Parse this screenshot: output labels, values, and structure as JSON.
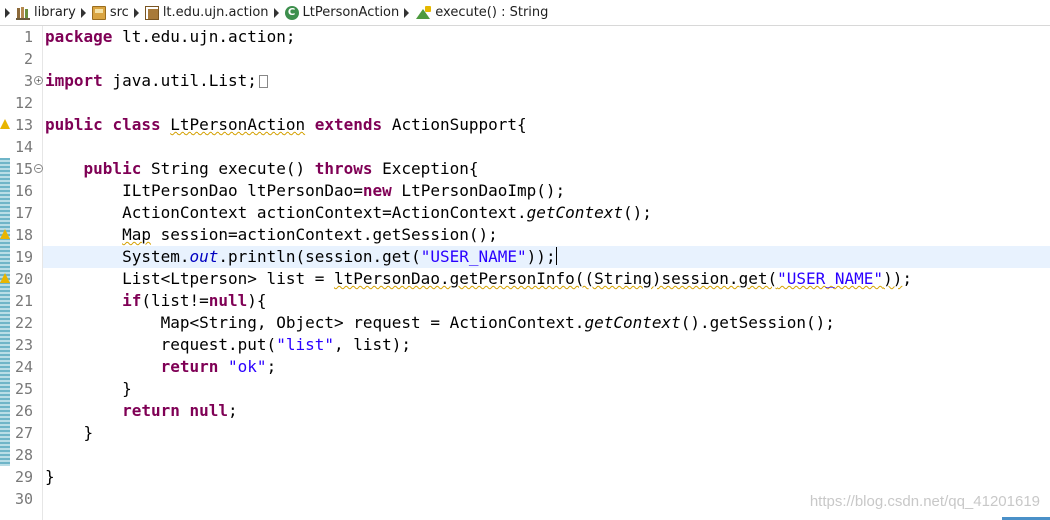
{
  "breadcrumb": {
    "items": [
      {
        "label": "library",
        "icon": "library-icon"
      },
      {
        "label": "src",
        "icon": "source-folder-icon"
      },
      {
        "label": "lt.edu.ujn.action",
        "icon": "package-icon"
      },
      {
        "label": "LtPersonAction",
        "icon": "class-icon"
      },
      {
        "label": "execute() : String",
        "icon": "method-icon"
      }
    ]
  },
  "editor": {
    "line_numbers": [
      "1",
      "2",
      "3",
      "12",
      "13",
      "14",
      "15",
      "16",
      "17",
      "18",
      "19",
      "20",
      "21",
      "22",
      "23",
      "24",
      "25",
      "26",
      "27",
      "28",
      "29",
      "30"
    ],
    "lines": [
      [
        {
          "t": "package",
          "k": "kw"
        },
        {
          "t": " lt.edu.ujn.action;"
        }
      ],
      [],
      [
        {
          "t": "import",
          "k": "kw"
        },
        {
          "t": " java.util.List;"
        },
        {
          "t": "",
          "k": "box"
        }
      ],
      [],
      [
        {
          "t": "public",
          "k": "kw"
        },
        {
          "t": " "
        },
        {
          "t": "class",
          "k": "kw"
        },
        {
          "t": " "
        },
        {
          "t": "LtPersonAction",
          "k": "warn"
        },
        {
          "t": " "
        },
        {
          "t": "extends",
          "k": "kw"
        },
        {
          "t": " ActionSupport{"
        }
      ],
      [],
      [
        {
          "t": "    "
        },
        {
          "t": "public",
          "k": "kw"
        },
        {
          "t": " String execute() "
        },
        {
          "t": "throws",
          "k": "kw"
        },
        {
          "t": " Exception{"
        }
      ],
      [
        {
          "t": "        ILtPersonDao ltPersonDao="
        },
        {
          "t": "new",
          "k": "kw"
        },
        {
          "t": " LtPersonDaoImp();"
        }
      ],
      [
        {
          "t": "        ActionContext actionContext=ActionContext."
        },
        {
          "t": "getContext",
          "k": "italm"
        },
        {
          "t": "();"
        }
      ],
      [
        {
          "t": "        "
        },
        {
          "t": "Map",
          "k": "warn"
        },
        {
          "t": " session=actionContext.getSession();"
        }
      ],
      [
        {
          "t": "        System."
        },
        {
          "t": "out",
          "k": "ital"
        },
        {
          "t": ".println(session.get("
        },
        {
          "t": "\"USER_NAME\"",
          "k": "str"
        },
        {
          "t": "));"
        },
        {
          "t": "",
          "k": "caret"
        }
      ],
      [
        {
          "t": "        List<Ltperson> list = "
        },
        {
          "t": "ltPersonDao.getPersonInfo((String)session.get(",
          "k": "warn"
        },
        {
          "t": "\"USER_NAME\"",
          "k": "strwarn"
        },
        {
          "t": "))",
          "k": "warn"
        },
        {
          "t": ";"
        }
      ],
      [
        {
          "t": "        "
        },
        {
          "t": "if",
          "k": "kw"
        },
        {
          "t": "(list!="
        },
        {
          "t": "null",
          "k": "kw"
        },
        {
          "t": "){"
        }
      ],
      [
        {
          "t": "            Map<String, Object> request = ActionContext."
        },
        {
          "t": "getContext",
          "k": "italm"
        },
        {
          "t": "().getSession();"
        }
      ],
      [
        {
          "t": "            request.put("
        },
        {
          "t": "\"list\"",
          "k": "str"
        },
        {
          "t": ", list);"
        }
      ],
      [
        {
          "t": "            "
        },
        {
          "t": "return",
          "k": "kw"
        },
        {
          "t": " "
        },
        {
          "t": "\"ok\"",
          "k": "str"
        },
        {
          "t": ";"
        }
      ],
      [
        {
          "t": "        }"
        }
      ],
      [
        {
          "t": "        "
        },
        {
          "t": "return",
          "k": "kw"
        },
        {
          "t": " "
        },
        {
          "t": "null",
          "k": "kw"
        },
        {
          "t": ";"
        }
      ],
      [
        {
          "t": "    }"
        }
      ],
      [],
      [
        {
          "t": "}"
        }
      ],
      []
    ],
    "highlighted_line_index": 10,
    "fold_marks": {
      "2": "+",
      "6": "−"
    },
    "warning_line_indices": [
      4,
      9,
      11
    ]
  },
  "watermark": "https://blog.csdn.net/qq_41201619",
  "colors": {
    "keyword": "#7f0055",
    "string": "#2a00ff",
    "static_field": "#0000c0",
    "current_line": "#e8f2fe",
    "warning": "#e8b500"
  }
}
